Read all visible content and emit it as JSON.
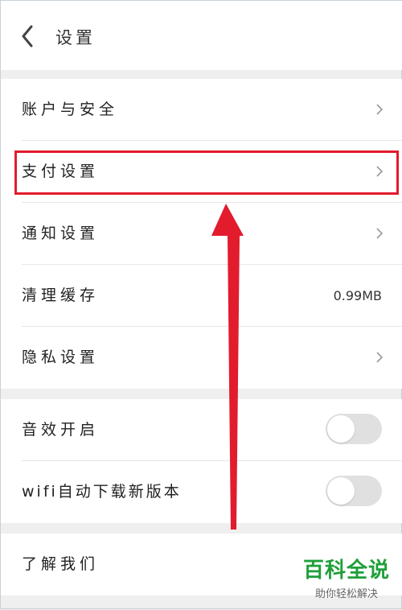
{
  "header": {
    "title": "设置"
  },
  "group1": {
    "items": [
      {
        "label": "账户与安全",
        "icon": "chevron-right-icon"
      },
      {
        "label": "支付设置",
        "icon": "chevron-right-icon"
      },
      {
        "label": "通知设置",
        "icon": "chevron-right-icon"
      },
      {
        "label": "清理缓存",
        "value": "0.99MB"
      },
      {
        "label": "隐私设置",
        "icon": "chevron-right-icon"
      }
    ]
  },
  "group2": {
    "items": [
      {
        "label": "音效开启",
        "toggle_on": false
      },
      {
        "label": "wifi自动下载新版本",
        "toggle_on": false
      }
    ]
  },
  "group3": {
    "items": [
      {
        "label": "了解我们"
      }
    ]
  },
  "annotation": {
    "highlight_color": "#e21b2d",
    "arrow_color": "#e21b2d"
  },
  "watermark": {
    "title": "百科全说",
    "subtitle": "助你轻松解决"
  },
  "colors": {
    "background": "#efeff0",
    "toggle_off": "#e0e0e0",
    "watermark_green": "#1f9f3a"
  }
}
